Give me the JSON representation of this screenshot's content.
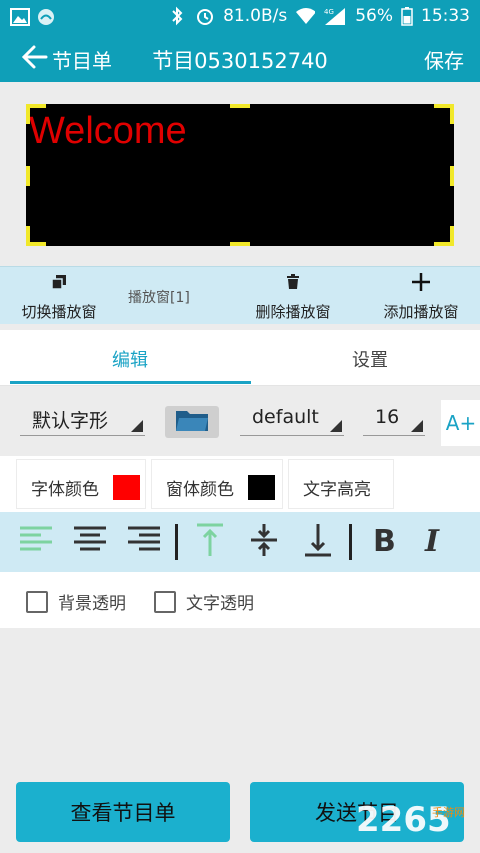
{
  "status_bar": {
    "speed": "81.0B/s",
    "battery": "56%",
    "time": "15:33",
    "network": "4G"
  },
  "app_bar": {
    "back_label": "节目单",
    "title": "节目0530152740",
    "save_label": "保存"
  },
  "preview": {
    "text": "Welcome",
    "text_color": "#e00000",
    "background": "#000000"
  },
  "window_bar": {
    "switch_label": "切换播放窗",
    "current_window": "播放窗[1]",
    "delete_label": "删除播放窗",
    "add_label": "添加播放窗"
  },
  "tabs": [
    {
      "label": "编辑",
      "active": true
    },
    {
      "label": "设置",
      "active": false
    }
  ],
  "font_row": {
    "font_shape": "默认字形",
    "font_name": "default",
    "font_size": "16",
    "size_up_label": "A+"
  },
  "color_row": {
    "font_color_label": "字体颜色",
    "font_color": "#ff0000",
    "window_color_label": "窗体颜色",
    "window_color": "#000000",
    "highlight_label": "文字高亮"
  },
  "checkboxes": {
    "bg_transparent": {
      "label": "背景透明",
      "checked": false
    },
    "text_transparent": {
      "label": "文字透明",
      "checked": false
    }
  },
  "bottom": {
    "view_list_label": "查看节目单",
    "send_label": "发送节目"
  },
  "watermark": {
    "text": "2265",
    "sub": "手游网"
  },
  "colors": {
    "accent": "#0f9fb8",
    "button": "#1bb0ce",
    "toolbar_bg": "#cfeaf4"
  }
}
